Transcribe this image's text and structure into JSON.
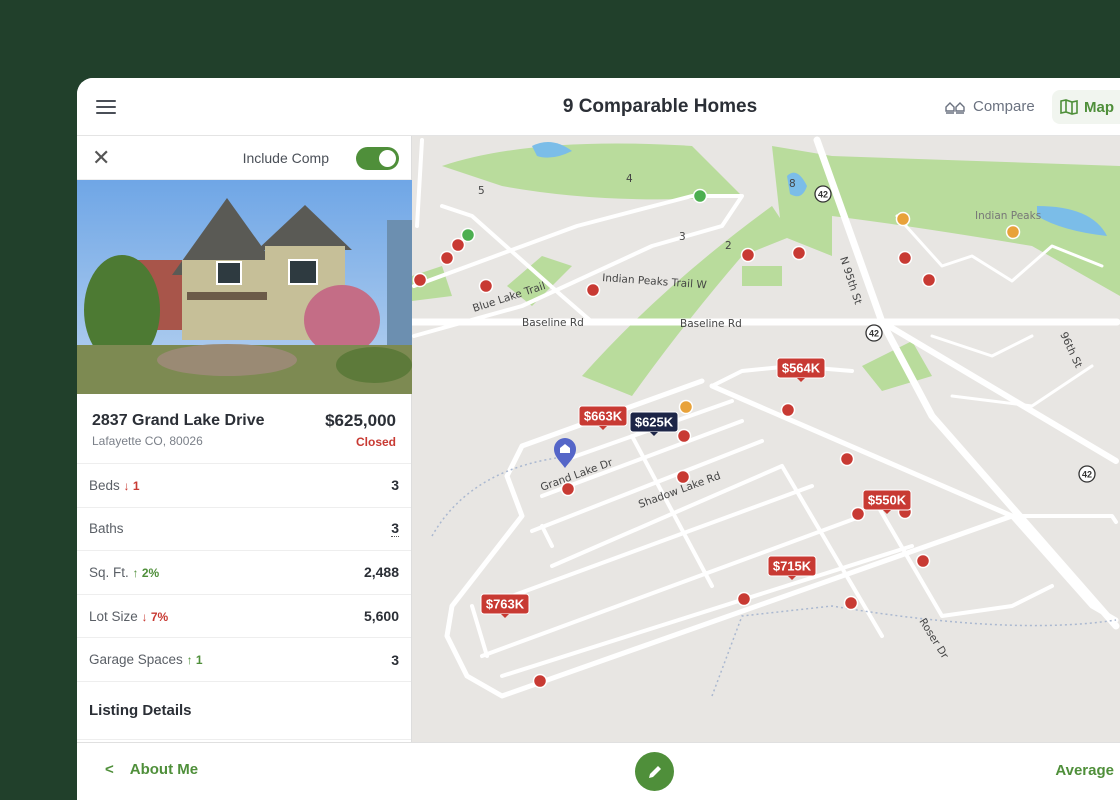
{
  "header": {
    "title": "9 Comparable Homes",
    "compare_label": "Compare",
    "map_label": "Map"
  },
  "panel": {
    "include_label": "Include Comp",
    "include_on": true,
    "street": "2837 Grand Lake Drive",
    "city": "Lafayette CO, 80026",
    "price": "$625,000",
    "status": "Closed",
    "rows": [
      {
        "label": "Beds",
        "delta": "↓ 1",
        "dir": "down",
        "value": "3"
      },
      {
        "label": "Baths",
        "delta": "",
        "dir": "",
        "value": "3"
      },
      {
        "label": "Sq. Ft.",
        "delta": "↑ 2%",
        "dir": "up",
        "value": "2,488"
      },
      {
        "label": "Lot Size",
        "delta": "↓ 7%",
        "dir": "down",
        "value": "5,600"
      },
      {
        "label": "Garage Spaces",
        "delta": "↑ 1",
        "dir": "up",
        "value": "3"
      }
    ],
    "section_title": "Listing Details"
  },
  "map": {
    "labels": {
      "blue_lake": "Blue Lake Trail",
      "indian_peaks_trail": "Indian Peaks Trail W",
      "baseline1": "Baseline Rd",
      "baseline2": "Baseline Rd",
      "n95": "N 95th St",
      "s96": "96th St",
      "indian_peaks": "Indian Peaks",
      "grand_lake": "Grand Lake Dr",
      "shadow_lake": "Shadow Lake Rd",
      "roser": "Roser Dr",
      "route1": "42",
      "route2": "42",
      "route3": "42",
      "h5": "5",
      "h4": "4",
      "h3": "3",
      "h2": "2",
      "h8": "8"
    },
    "price_tags": [
      "$564K",
      "$663K",
      "$625K",
      "$550K",
      "$715K",
      "$763K"
    ],
    "colors": {
      "sold": "#c83a33",
      "active": "#4caf50",
      "pending": "#e8a23a",
      "selected": "#1d2547",
      "subject": "#5566c8"
    }
  },
  "footer": {
    "back_label": "About Me",
    "next_label": "Average"
  },
  "colors": {
    "accent": "#4f8f3a",
    "background": "#21402b"
  }
}
